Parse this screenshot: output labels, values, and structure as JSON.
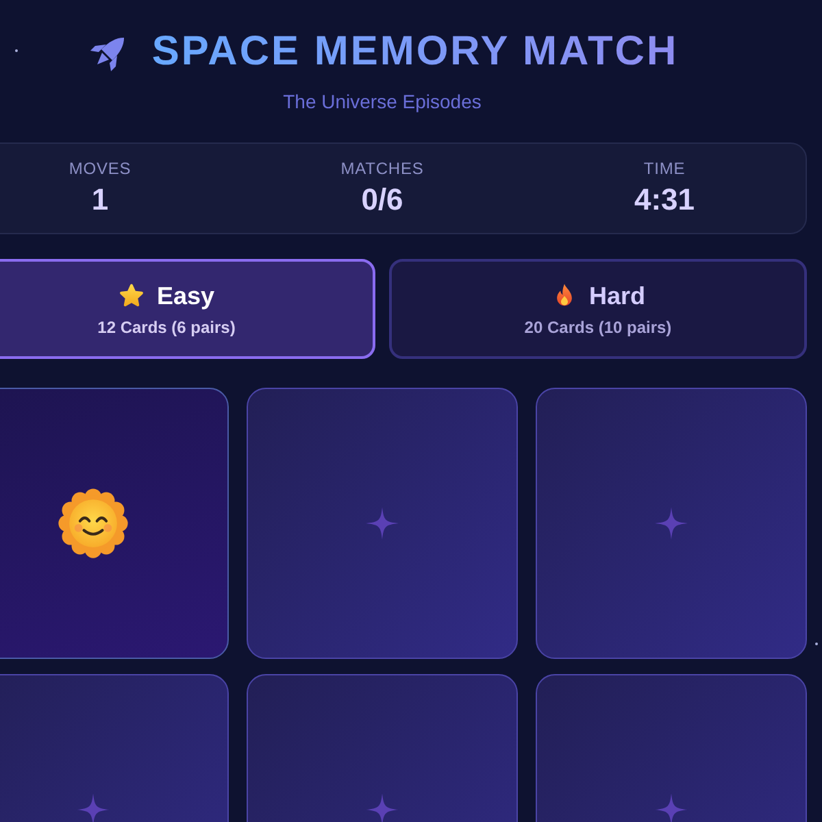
{
  "header": {
    "title": "SPACE MEMORY MATCH",
    "subtitle": "The Universe Episodes"
  },
  "stats": [
    {
      "label": "MOVES",
      "value": "1"
    },
    {
      "label": "MATCHES",
      "value": "0/6"
    },
    {
      "label": "TIME",
      "value": "4:31"
    }
  ],
  "difficulty": [
    {
      "kind": "easy",
      "label": "Easy",
      "detail": "12 Cards (6 pairs)",
      "selected": true
    },
    {
      "kind": "hard",
      "label": "Hard",
      "detail": "20 Cards (10 pairs)",
      "selected": false
    }
  ],
  "cards": [
    {
      "flipped": true
    },
    {
      "flipped": false
    },
    {
      "flipped": false
    },
    {
      "flipped": false
    },
    {
      "flipped": false
    },
    {
      "flipped": false
    }
  ]
}
